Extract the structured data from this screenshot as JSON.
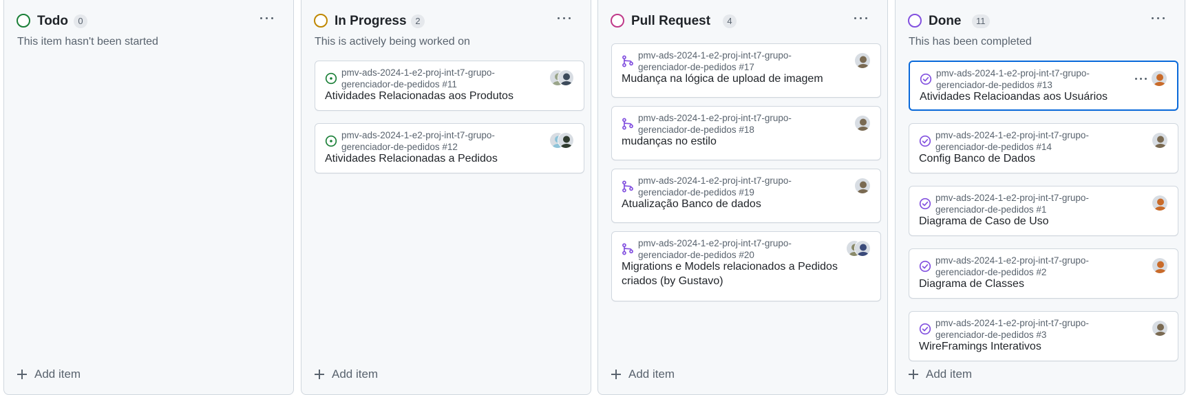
{
  "columns": [
    {
      "id": "todo",
      "title": "Todo",
      "count": "0",
      "status_color": "#1a7f37",
      "description": "This item hasn't been started",
      "add_label": "Add item",
      "cards": []
    },
    {
      "id": "in-progress",
      "title": "In Progress",
      "count": "2",
      "status_color": "#bf8700",
      "description": "This is actively being worked on",
      "add_label": "Add item",
      "cards": [
        {
          "icon": "issue-open-icon",
          "icon_color": "#1a7f37",
          "repo": "pmv-ads-2024-1-e2-proj-int-t7-grupo-gerenciador-de-pedidos #11",
          "title": "Atividades Relacionadas aos Produtos",
          "avatars": [
            "#9aa58a",
            "#3c4a5a"
          ]
        },
        {
          "icon": "issue-open-icon",
          "icon_color": "#1a7f37",
          "repo": "pmv-ads-2024-1-e2-proj-int-t7-grupo-gerenciador-de-pedidos #12",
          "title": "Atividades Relacionadas a Pedidos",
          "avatars": [
            "#8ec3d8",
            "#2f3b2f"
          ]
        }
      ]
    },
    {
      "id": "pull-request",
      "title": "Pull Request",
      "count": "4",
      "status_color": "#bf3989",
      "description": "",
      "add_label": "Add item",
      "cards": [
        {
          "icon": "pull-request-icon",
          "icon_color": "#8250df",
          "repo": "pmv-ads-2024-1-e2-proj-int-t7-grupo-gerenciador-de-pedidos #17",
          "title": "Mudança na lógica de upload de imagem",
          "avatars": [
            "#7a6a52"
          ]
        },
        {
          "icon": "pull-request-icon",
          "icon_color": "#8250df",
          "repo": "pmv-ads-2024-1-e2-proj-int-t7-grupo-gerenciador-de-pedidos #18",
          "title": "mudanças no estilo",
          "avatars": [
            "#7a6a52"
          ]
        },
        {
          "icon": "pull-request-icon",
          "icon_color": "#8250df",
          "repo": "pmv-ads-2024-1-e2-proj-int-t7-grupo-gerenciador-de-pedidos #19",
          "title": "Atualização Banco de dados",
          "avatars": [
            "#7a6a52"
          ]
        },
        {
          "icon": "pull-request-icon",
          "icon_color": "#8250df",
          "repo": "pmv-ads-2024-1-e2-proj-int-t7-grupo-gerenciador-de-pedidos #20",
          "title": "Migrations e Models relacionados a Pedidos criados (by Gustavo)",
          "avatars": [
            "#8a8a6a",
            "#3a4a7a"
          ]
        }
      ]
    },
    {
      "id": "done",
      "title": "Done",
      "count": "11",
      "status_color": "#8250df",
      "description": "This has been completed",
      "add_label": "Add item",
      "cards": [
        {
          "icon": "issue-closed-icon",
          "icon_color": "#8250df",
          "repo": "pmv-ads-2024-1-e2-proj-int-t7-grupo-gerenciador-de-pedidos #13",
          "title": "Atividades Relacioandas aos Usuários",
          "avatars": [
            "#c96b2a"
          ],
          "selected": true
        },
        {
          "icon": "issue-closed-icon",
          "icon_color": "#8250df",
          "repo": "pmv-ads-2024-1-e2-proj-int-t7-grupo-gerenciador-de-pedidos #14",
          "title": "Config Banco de Dados",
          "avatars": [
            "#7a6a52"
          ]
        },
        {
          "icon": "issue-closed-icon",
          "icon_color": "#8250df",
          "repo": "pmv-ads-2024-1-e2-proj-int-t7-grupo-gerenciador-de-pedidos #1",
          "title": "Diagrama de Caso de Uso",
          "avatars": [
            "#c96b2a"
          ]
        },
        {
          "icon": "issue-closed-icon",
          "icon_color": "#8250df",
          "repo": "pmv-ads-2024-1-e2-proj-int-t7-grupo-gerenciador-de-pedidos #2",
          "title": "Diagrama de Classes",
          "avatars": [
            "#c96b2a"
          ]
        },
        {
          "icon": "issue-closed-icon",
          "icon_color": "#8250df",
          "repo": "pmv-ads-2024-1-e2-proj-int-t7-grupo-gerenciador-de-pedidos #3",
          "title": "WireFramings Interativos",
          "avatars": [
            "#7a6a52"
          ]
        }
      ]
    }
  ]
}
